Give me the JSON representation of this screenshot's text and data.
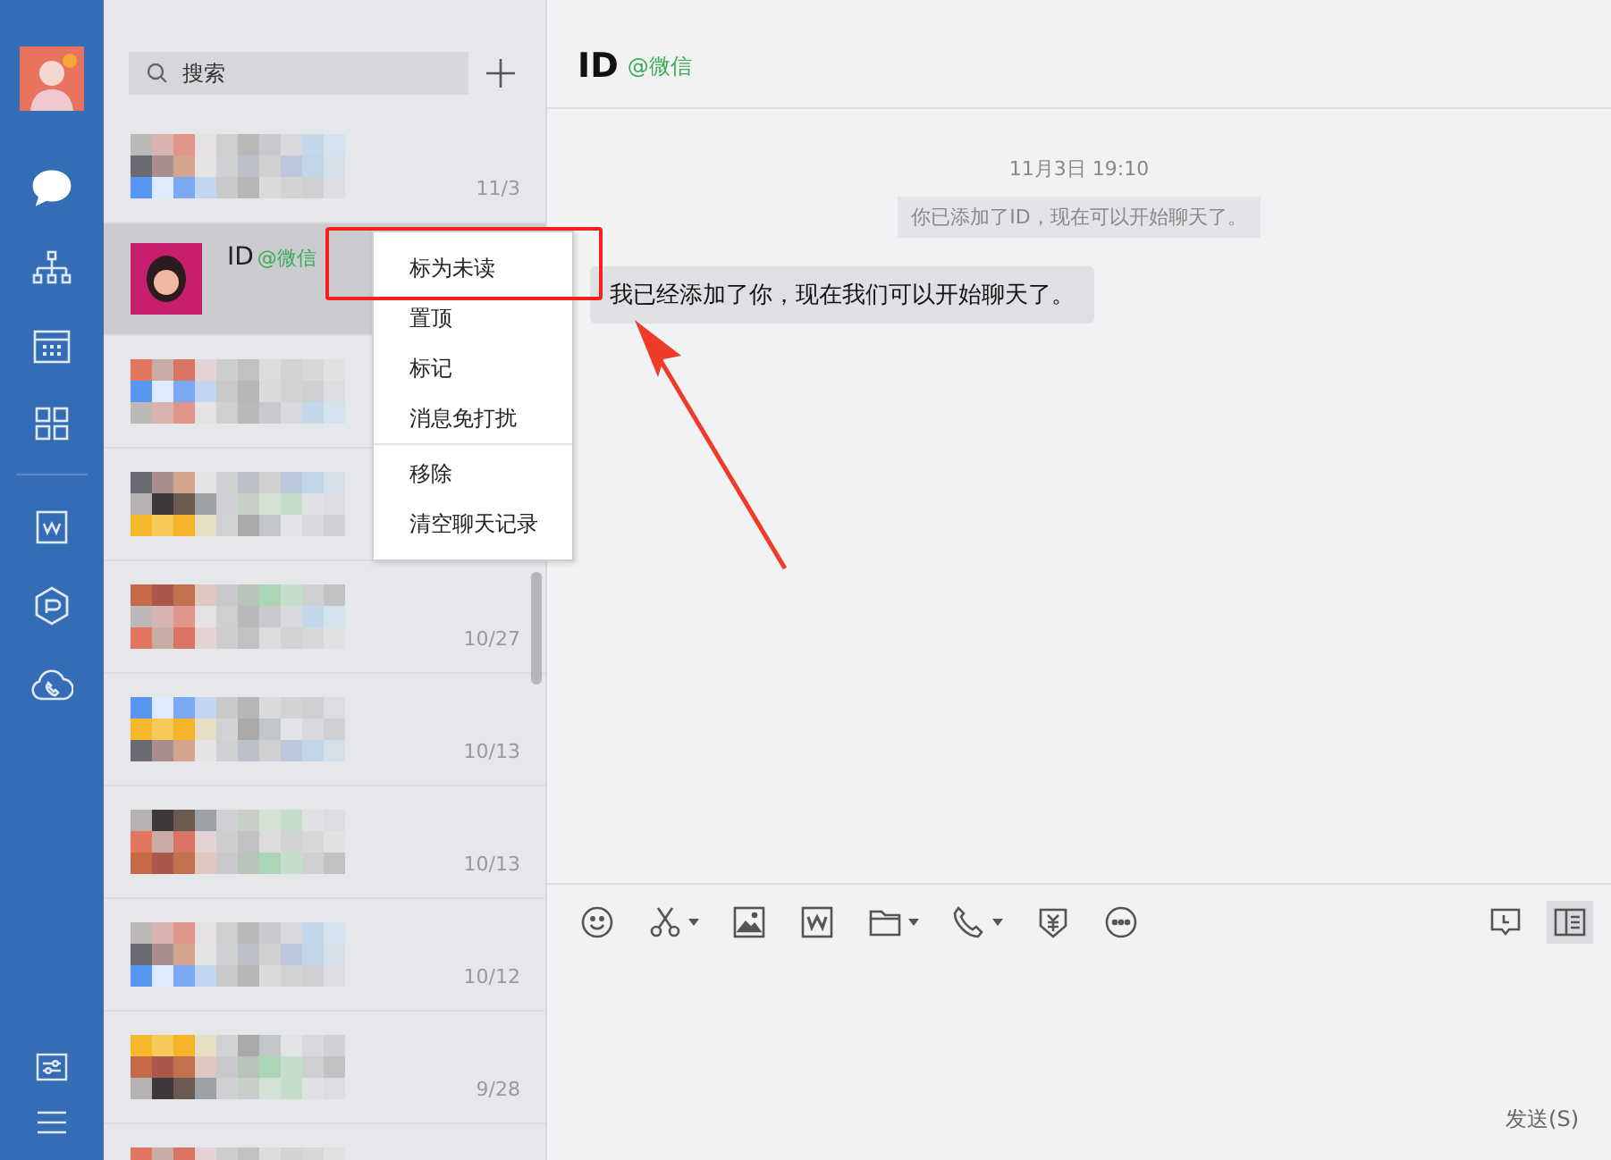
{
  "sidebar": {
    "items": [
      {
        "kind": "chat",
        "selected": true
      },
      {
        "kind": "org",
        "selected": false
      },
      {
        "kind": "calendar",
        "selected": false
      },
      {
        "kind": "apps",
        "selected": false
      },
      {
        "kind": "doc",
        "selected": false
      },
      {
        "kind": "hex",
        "selected": false
      },
      {
        "kind": "phone",
        "selected": false
      }
    ],
    "bottom": [
      {
        "kind": "sliders"
      },
      {
        "kind": "menu"
      }
    ]
  },
  "search": {
    "placeholder": "搜索"
  },
  "chats": [
    {
      "kind": "blurred",
      "date": "11/3",
      "selected": false
    },
    {
      "kind": "contact",
      "name": "ID",
      "tag": "@微信",
      "selected": true
    },
    {
      "kind": "blurred",
      "selected": false
    },
    {
      "kind": "blurred",
      "selected": false
    },
    {
      "kind": "blurred",
      "date": "10/27",
      "selected": false
    },
    {
      "kind": "blurred",
      "date": "10/13",
      "selected": false
    },
    {
      "kind": "blurred",
      "date": "10/13",
      "selected": false
    },
    {
      "kind": "blurred",
      "date": "10/12",
      "selected": false
    },
    {
      "kind": "blurred",
      "date": "9/28",
      "selected": false
    },
    {
      "kind": "blurred",
      "selected": false
    }
  ],
  "context_menu": {
    "groups": [
      [
        "标为未读",
        "置顶",
        "标记",
        "消息免打扰"
      ],
      [
        "移除",
        "清空聊天记录"
      ]
    ]
  },
  "conversation": {
    "title": "ID",
    "tag": "@微信",
    "time": "11月3日 19:10",
    "notice": "你已添加了ID，现在可以开始聊天了。",
    "message": "我已经添加了你，现在我们可以开始聊天了。"
  },
  "toolbar": {
    "left": [
      {
        "kind": "emoji",
        "dropdown": false
      },
      {
        "kind": "scissors",
        "dropdown": true
      },
      {
        "kind": "image",
        "dropdown": false
      },
      {
        "kind": "doc",
        "dropdown": false
      },
      {
        "kind": "folder",
        "dropdown": true
      },
      {
        "kind": "phone",
        "dropdown": true
      },
      {
        "kind": "money",
        "dropdown": false
      },
      {
        "kind": "more",
        "dropdown": false
      }
    ],
    "right": [
      {
        "kind": "history",
        "selected": false
      },
      {
        "kind": "panel",
        "selected": true
      }
    ]
  },
  "send_button": "发送(S)"
}
